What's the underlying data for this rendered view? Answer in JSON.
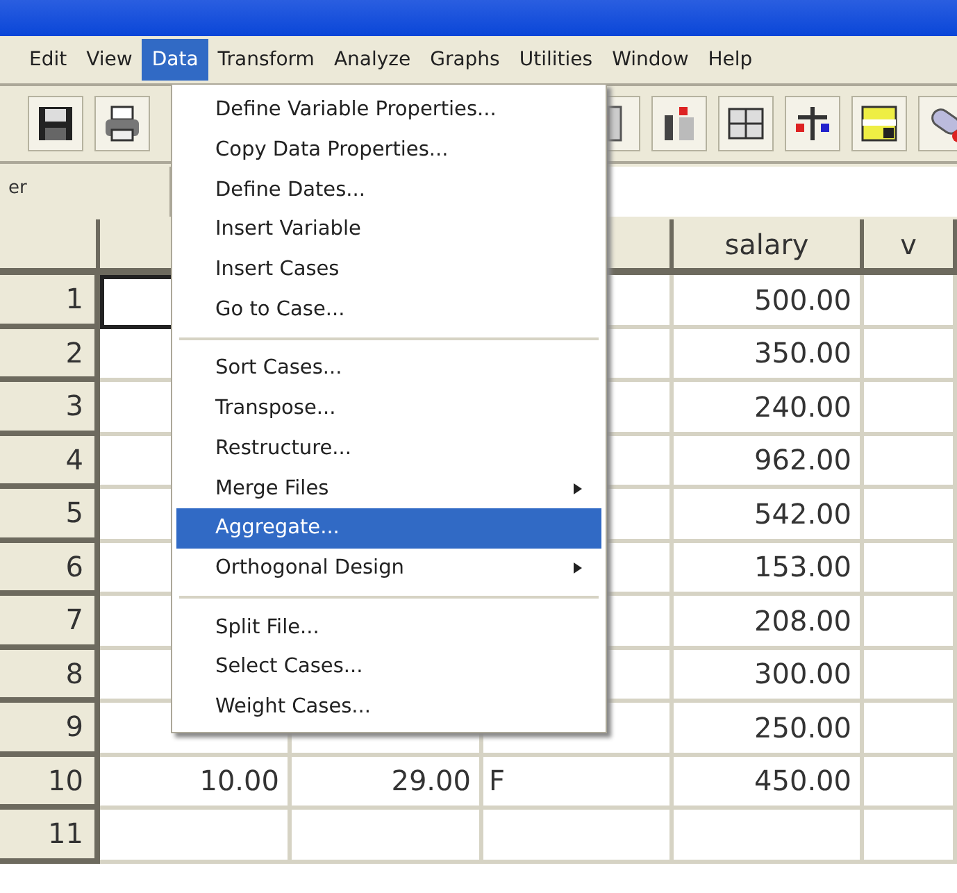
{
  "menu_bar": [
    {
      "label": "Edit",
      "selected": false
    },
    {
      "label": "View",
      "selected": false
    },
    {
      "label": "Data",
      "selected": true
    },
    {
      "label": "Transform",
      "selected": false
    },
    {
      "label": "Analyze",
      "selected": false
    },
    {
      "label": "Graphs",
      "selected": false
    },
    {
      "label": "Utilities",
      "selected": false
    },
    {
      "label": "Window",
      "selected": false
    },
    {
      "label": "Help",
      "selected": false
    }
  ],
  "cell_label": "er",
  "table": {
    "columns": [
      null,
      null,
      null,
      "salary",
      "v"
    ],
    "rows": [
      {
        "number": "1",
        "cells": [
          null,
          null,
          null,
          "500.00",
          null
        ]
      },
      {
        "number": "2",
        "cells": [
          null,
          null,
          null,
          "350.00",
          null
        ]
      },
      {
        "number": "3",
        "cells": [
          null,
          null,
          null,
          "240.00",
          null
        ]
      },
      {
        "number": "4",
        "cells": [
          null,
          null,
          null,
          "962.00",
          null
        ]
      },
      {
        "number": "5",
        "cells": [
          null,
          null,
          null,
          "542.00",
          null
        ]
      },
      {
        "number": "6",
        "cells": [
          null,
          null,
          null,
          "153.00",
          null
        ]
      },
      {
        "number": "7",
        "cells": [
          null,
          null,
          null,
          "208.00",
          null
        ]
      },
      {
        "number": "8",
        "cells": [
          null,
          null,
          null,
          "300.00",
          null
        ]
      },
      {
        "number": "9",
        "cells": [
          null,
          null,
          null,
          "250.00",
          null
        ]
      },
      {
        "number": "10",
        "cells": [
          "10.00",
          "29.00",
          "F",
          "450.00",
          null
        ]
      },
      {
        "number": "11",
        "cells": [
          null,
          null,
          null,
          null,
          null
        ]
      }
    ]
  },
  "dropdown_menu": {
    "groups": [
      [
        {
          "label": "Define Variable Properties...",
          "submenu": false,
          "selected": false
        },
        {
          "label": "Copy Data Properties...",
          "submenu": false,
          "selected": false
        },
        {
          "label": "Define Dates...",
          "submenu": false,
          "selected": false
        },
        {
          "label": "Insert Variable",
          "submenu": false,
          "selected": false
        },
        {
          "label": "Insert Cases",
          "submenu": false,
          "selected": false
        },
        {
          "label": "Go to Case...",
          "submenu": false,
          "selected": false
        }
      ],
      [
        {
          "label": "Sort Cases...",
          "submenu": false,
          "selected": false
        },
        {
          "label": "Transpose...",
          "submenu": false,
          "selected": false
        },
        {
          "label": "Restructure...",
          "submenu": false,
          "selected": false
        },
        {
          "label": "Merge Files",
          "submenu": true,
          "selected": false
        },
        {
          "label": "Aggregate...",
          "submenu": false,
          "selected": true
        },
        {
          "label": "Orthogonal Design",
          "submenu": true,
          "selected": false
        }
      ],
      [
        {
          "label": "Split File...",
          "submenu": false,
          "selected": false
        },
        {
          "label": "Select Cases...",
          "submenu": false,
          "selected": false
        },
        {
          "label": "Weight Cases...",
          "submenu": false,
          "selected": false
        }
      ]
    ]
  }
}
